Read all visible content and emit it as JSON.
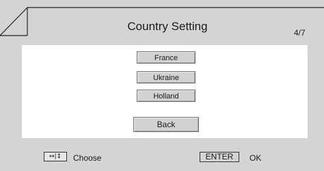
{
  "header": {
    "title": "Country Setting",
    "page_indicator": "4/7"
  },
  "options": [
    {
      "label": "France"
    },
    {
      "label": "Ukraine"
    },
    {
      "label": "Holland"
    }
  ],
  "back_label": "Back",
  "footer": {
    "nav_icon": "↔|↕",
    "choose_label": "Choose",
    "enter_key_label": "ENTER",
    "ok_label": "OK"
  },
  "colors": {
    "background": "#d4d4d4",
    "panel": "#ffffff",
    "button": "#d2d2d2"
  }
}
